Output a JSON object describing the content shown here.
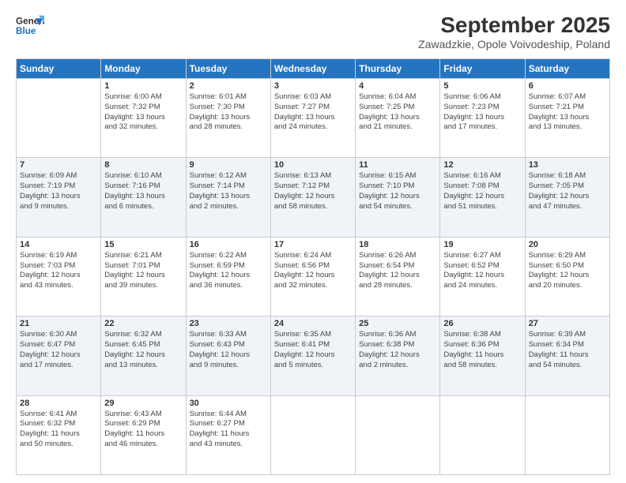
{
  "header": {
    "logo_line1": "General",
    "logo_line2": "Blue",
    "month": "September 2025",
    "location": "Zawadzkie, Opole Voivodeship, Poland"
  },
  "days_of_week": [
    "Sunday",
    "Monday",
    "Tuesday",
    "Wednesday",
    "Thursday",
    "Friday",
    "Saturday"
  ],
  "weeks": [
    [
      {
        "day": "",
        "info": ""
      },
      {
        "day": "1",
        "info": "Sunrise: 6:00 AM\nSunset: 7:32 PM\nDaylight: 13 hours\nand 32 minutes."
      },
      {
        "day": "2",
        "info": "Sunrise: 6:01 AM\nSunset: 7:30 PM\nDaylight: 13 hours\nand 28 minutes."
      },
      {
        "day": "3",
        "info": "Sunrise: 6:03 AM\nSunset: 7:27 PM\nDaylight: 13 hours\nand 24 minutes."
      },
      {
        "day": "4",
        "info": "Sunrise: 6:04 AM\nSunset: 7:25 PM\nDaylight: 13 hours\nand 21 minutes."
      },
      {
        "day": "5",
        "info": "Sunrise: 6:06 AM\nSunset: 7:23 PM\nDaylight: 13 hours\nand 17 minutes."
      },
      {
        "day": "6",
        "info": "Sunrise: 6:07 AM\nSunset: 7:21 PM\nDaylight: 13 hours\nand 13 minutes."
      }
    ],
    [
      {
        "day": "7",
        "info": "Sunrise: 6:09 AM\nSunset: 7:19 PM\nDaylight: 13 hours\nand 9 minutes."
      },
      {
        "day": "8",
        "info": "Sunrise: 6:10 AM\nSunset: 7:16 PM\nDaylight: 13 hours\nand 6 minutes."
      },
      {
        "day": "9",
        "info": "Sunrise: 6:12 AM\nSunset: 7:14 PM\nDaylight: 13 hours\nand 2 minutes."
      },
      {
        "day": "10",
        "info": "Sunrise: 6:13 AM\nSunset: 7:12 PM\nDaylight: 12 hours\nand 58 minutes."
      },
      {
        "day": "11",
        "info": "Sunrise: 6:15 AM\nSunset: 7:10 PM\nDaylight: 12 hours\nand 54 minutes."
      },
      {
        "day": "12",
        "info": "Sunrise: 6:16 AM\nSunset: 7:08 PM\nDaylight: 12 hours\nand 51 minutes."
      },
      {
        "day": "13",
        "info": "Sunrise: 6:18 AM\nSunset: 7:05 PM\nDaylight: 12 hours\nand 47 minutes."
      }
    ],
    [
      {
        "day": "14",
        "info": "Sunrise: 6:19 AM\nSunset: 7:03 PM\nDaylight: 12 hours\nand 43 minutes."
      },
      {
        "day": "15",
        "info": "Sunrise: 6:21 AM\nSunset: 7:01 PM\nDaylight: 12 hours\nand 39 minutes."
      },
      {
        "day": "16",
        "info": "Sunrise: 6:22 AM\nSunset: 6:59 PM\nDaylight: 12 hours\nand 36 minutes."
      },
      {
        "day": "17",
        "info": "Sunrise: 6:24 AM\nSunset: 6:56 PM\nDaylight: 12 hours\nand 32 minutes."
      },
      {
        "day": "18",
        "info": "Sunrise: 6:26 AM\nSunset: 6:54 PM\nDaylight: 12 hours\nand 28 minutes."
      },
      {
        "day": "19",
        "info": "Sunrise: 6:27 AM\nSunset: 6:52 PM\nDaylight: 12 hours\nand 24 minutes."
      },
      {
        "day": "20",
        "info": "Sunrise: 6:29 AM\nSunset: 6:50 PM\nDaylight: 12 hours\nand 20 minutes."
      }
    ],
    [
      {
        "day": "21",
        "info": "Sunrise: 6:30 AM\nSunset: 6:47 PM\nDaylight: 12 hours\nand 17 minutes."
      },
      {
        "day": "22",
        "info": "Sunrise: 6:32 AM\nSunset: 6:45 PM\nDaylight: 12 hours\nand 13 minutes."
      },
      {
        "day": "23",
        "info": "Sunrise: 6:33 AM\nSunset: 6:43 PM\nDaylight: 12 hours\nand 9 minutes."
      },
      {
        "day": "24",
        "info": "Sunrise: 6:35 AM\nSunset: 6:41 PM\nDaylight: 12 hours\nand 5 minutes."
      },
      {
        "day": "25",
        "info": "Sunrise: 6:36 AM\nSunset: 6:38 PM\nDaylight: 12 hours\nand 2 minutes."
      },
      {
        "day": "26",
        "info": "Sunrise: 6:38 AM\nSunset: 6:36 PM\nDaylight: 11 hours\nand 58 minutes."
      },
      {
        "day": "27",
        "info": "Sunrise: 6:39 AM\nSunset: 6:34 PM\nDaylight: 11 hours\nand 54 minutes."
      }
    ],
    [
      {
        "day": "28",
        "info": "Sunrise: 6:41 AM\nSunset: 6:32 PM\nDaylight: 11 hours\nand 50 minutes."
      },
      {
        "day": "29",
        "info": "Sunrise: 6:43 AM\nSunset: 6:29 PM\nDaylight: 11 hours\nand 46 minutes."
      },
      {
        "day": "30",
        "info": "Sunrise: 6:44 AM\nSunset: 6:27 PM\nDaylight: 11 hours\nand 43 minutes."
      },
      {
        "day": "",
        "info": ""
      },
      {
        "day": "",
        "info": ""
      },
      {
        "day": "",
        "info": ""
      },
      {
        "day": "",
        "info": ""
      }
    ]
  ]
}
